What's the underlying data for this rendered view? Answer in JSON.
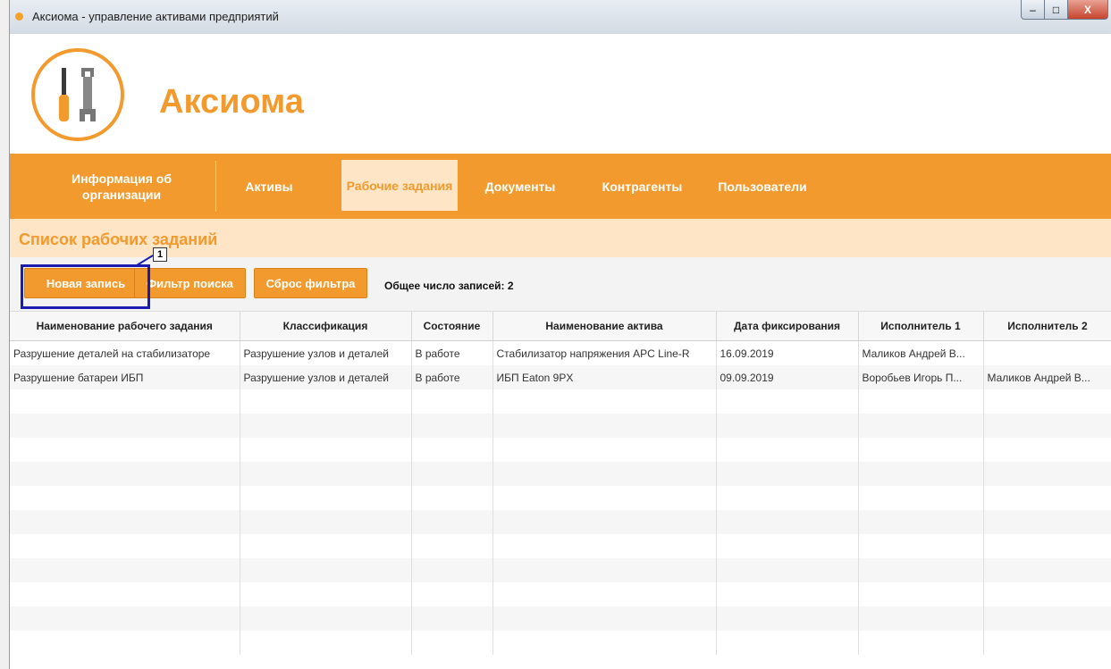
{
  "window": {
    "title": "Аксиома - управление активами предприятий",
    "controls": {
      "minimize": "‒",
      "maximize": "□",
      "close": "X"
    }
  },
  "header": {
    "app_name": "Аксиома",
    "logo_icon": "tools-icon"
  },
  "nav": {
    "items": [
      {
        "label": "Информация об организации"
      },
      {
        "label": "Активы"
      },
      {
        "label": "Рабочие задания",
        "active": true
      },
      {
        "label": "Документы"
      },
      {
        "label": "Контрагенты"
      },
      {
        "label": "Пользователи"
      }
    ]
  },
  "section": {
    "title": "Список рабочих заданий"
  },
  "toolbar": {
    "new_record": "Новая запись",
    "search_filter": "Фильтр поиска",
    "reset_filter": "Сброс фильтра",
    "total": "Общее число записей: 2",
    "callout": "1"
  },
  "table": {
    "columns": [
      "Наименование рабочего задания",
      "Классификация",
      "Состояние",
      "Наименование актива",
      "Дата фиксирования",
      "Исполнитель 1",
      "Исполнитель 2"
    ],
    "rows": [
      [
        "Разрушение деталей на стабилизаторе",
        "Разрушение узлов и деталей",
        "В работе",
        "Стабилизатор напряжения APC Line-R",
        "16.09.2019",
        "Маликов Андрей В...",
        ""
      ],
      [
        "Разрушение батареи ИБП",
        "Разрушение узлов и деталей",
        "В работе",
        "ИБП Eaton 9PX",
        "09.09.2019",
        "Воробьев Игорь П...",
        "Маликов Андрей В..."
      ]
    ]
  },
  "colors": {
    "accent": "#f29a2e",
    "accent_light": "#fde5c6",
    "highlight": "#1c1cb0"
  }
}
